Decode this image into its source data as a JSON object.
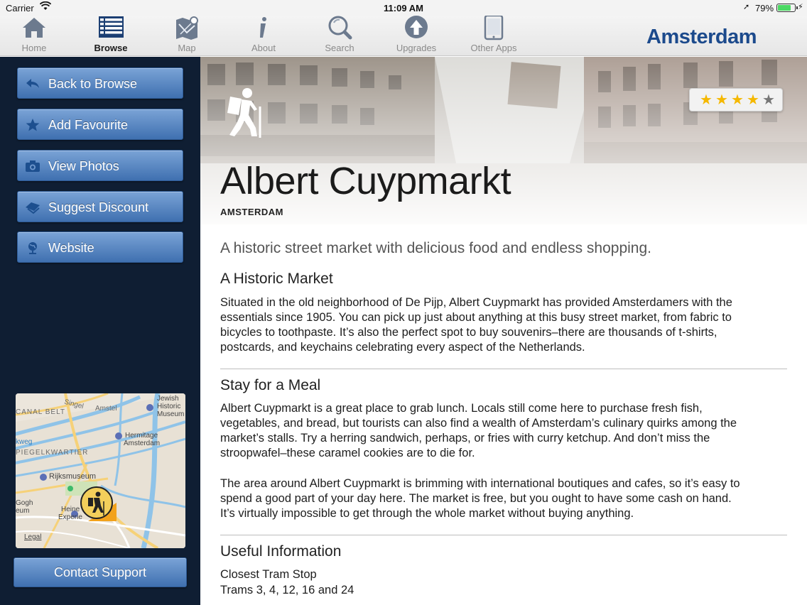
{
  "status_bar": {
    "carrier": "Carrier",
    "time": "11:09 AM",
    "battery": "79%"
  },
  "tabs": [
    {
      "label": "Home",
      "icon": "home-icon"
    },
    {
      "label": "Browse",
      "icon": "list-icon",
      "active": true
    },
    {
      "label": "Map",
      "icon": "map-icon"
    },
    {
      "label": "About",
      "icon": "info-icon"
    },
    {
      "label": "Search",
      "icon": "search-icon"
    },
    {
      "label": "Upgrades",
      "icon": "upgrade-arrow-icon"
    },
    {
      "label": "Other Apps",
      "icon": "tablet-icon"
    }
  ],
  "brand": "Amsterdam",
  "sidebar": {
    "buttons": [
      {
        "label": "Back to Browse",
        "icon": "back-arrow-icon"
      },
      {
        "label": "Add Favourite",
        "icon": "star-icon"
      },
      {
        "label": "View Photos",
        "icon": "camera-icon"
      },
      {
        "label": "Suggest Discount",
        "icon": "ticket-icon"
      },
      {
        "label": "Website",
        "icon": "globe-icon"
      }
    ],
    "map_labels": {
      "jewish": "Jewish",
      "historic": "Historic",
      "museum": "Museum",
      "canal_belt": "CANAL BELT",
      "singel": "Singel",
      "amstel": "Amstel",
      "hermitage": "Hermitage",
      "amsterdam": "Amsterdam",
      "kweg": "kweg",
      "spiegelkwartier": "PIEGELKWARTIER",
      "rijksmuseum": "Rijksmuseum",
      "gogh": "Gogh",
      "eum": "eum",
      "heine": "Heine",
      "experie": "Experie",
      "legal": "Legal"
    },
    "contact_label": "Contact Support"
  },
  "place": {
    "title": "Albert Cuypmarkt",
    "city": "AMSTERDAM",
    "rating": 4,
    "rating_max": 5,
    "category_icon": "hiker-icon",
    "tagline": "A historic street market with delicious food and endless shopping."
  },
  "sections": {
    "historic": {
      "heading": "A Historic Market",
      "lines": [
        "Situated in the old neighborhood of De Pijp, Albert Cuypmarkt has provided Amsterdamers with the",
        "essentials since 1905. You can pick up just about anything at this busy street market, from fabric to",
        "bicycles to toothpaste. It’s also the perfect spot to buy souvenirs–there are thousands of t-shirts,",
        "postcards, and keychains celebrating every aspect of the Netherlands."
      ]
    },
    "meal": {
      "heading": "Stay for a Meal",
      "lines": [
        "Albert Cuypmarkt is a great place to grab lunch. Locals still come here to purchase fresh fish,",
        "vegetables, and bread, but tourists can also find a wealth of Amsterdam’s culinary quirks among the",
        "market’s stalls. Try a herring sandwich, perhaps, or fries with curry ketchup. And don’t miss the",
        "stroopwafel–these caramel cookies are to die for."
      ],
      "lines2": [
        "The area around Albert Cuypmarkt is brimming with international boutiques and cafes, so it’s easy to",
        "spend a good part of your day here. The market is free, but you ought to have some cash on hand.",
        "It’s virtually impossible to get through the whole market without buying anything."
      ]
    },
    "info": {
      "heading": "Useful Information",
      "tram_label": "Closest Tram Stop",
      "tram_value": "Trams 3, 4, 12, 16 and 24"
    }
  },
  "colors": {
    "sidebar_bg": "#0f1e33",
    "button_blue": "#4a7bbb",
    "brand_blue": "#1c4a8c",
    "star_gold": "#f5b800",
    "star_grey": "#777777"
  }
}
